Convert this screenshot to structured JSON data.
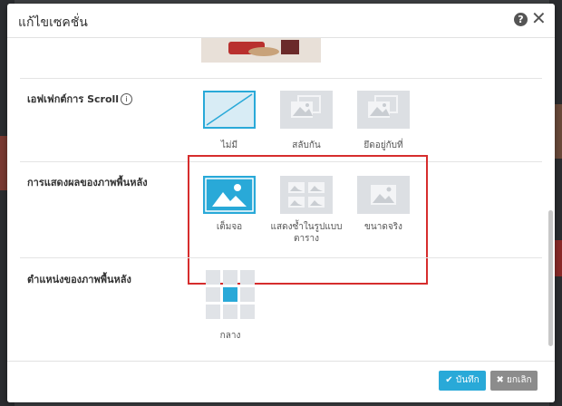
{
  "modal": {
    "title": "แก้ไขเซคชั่น",
    "help_icon": "help-icon",
    "close_icon": "close-icon"
  },
  "sections": {
    "scroll_effect": {
      "label": "เอฟเฟกต์การ Scroll",
      "options": [
        {
          "label": "ไม่มี",
          "icon": "none-slash-icon",
          "selected": true
        },
        {
          "label": "สลับกัน",
          "icon": "parallax-image-icon",
          "selected": false
        },
        {
          "label": "ยึดอยู่กับที่",
          "icon": "fixed-image-icon",
          "selected": false
        }
      ]
    },
    "background_display": {
      "label": "การแสดงผลของภาพพื้นหลัง",
      "options": [
        {
          "label": "เต็มจอ",
          "icon": "fullscreen-image-icon",
          "selected": true
        },
        {
          "label": "แสดงซ้ำในรูปแบบตาราง",
          "icon": "tiled-image-icon",
          "selected": false
        },
        {
          "label": "ขนาดจริง",
          "icon": "actual-size-image-icon",
          "selected": false
        }
      ]
    },
    "background_position": {
      "label": "ตำแหน่งของภาพพื้นหลัง",
      "selected_label": "กลาง"
    }
  },
  "footer": {
    "save_label": "บันทึก",
    "cancel_label": "ยกเลิก"
  },
  "colors": {
    "accent": "#29a9d8",
    "highlight": "#d62d2d",
    "cancel": "#8c8c8c"
  }
}
